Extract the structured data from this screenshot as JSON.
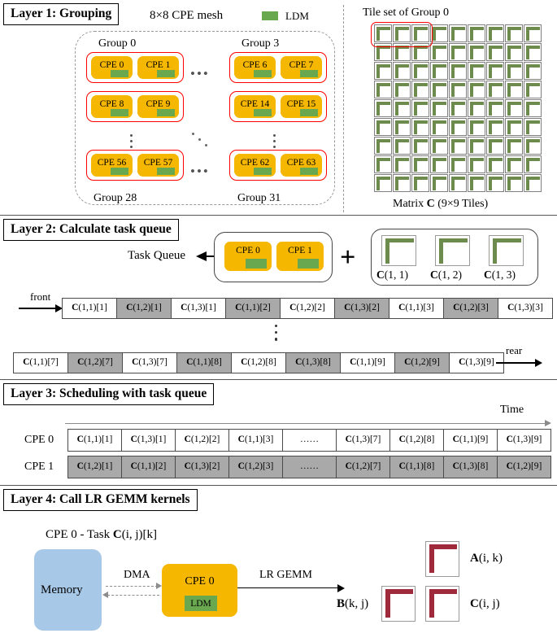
{
  "layers": [
    {
      "id": "layer1",
      "title": "Layer 1: Grouping"
    },
    {
      "id": "layer2",
      "title": "Layer 2: Calculate task queue"
    },
    {
      "id": "layer3",
      "title": "Layer 3: Scheduling with task queue"
    },
    {
      "id": "layer4",
      "title": "Layer 4: Call LR GEMM kernels"
    }
  ],
  "layer1": {
    "mesh_caption": "8×8 CPE mesh",
    "legend_label": "LDM",
    "group_labels": {
      "top_left": "Group 0",
      "top_right": "Group 3",
      "bottom_left": "Group 28",
      "bottom_right": "Group 31"
    },
    "cpe_rows": [
      {
        "left": [
          "CPE 0",
          "CPE 1"
        ],
        "right": [
          "CPE 6",
          "CPE 7"
        ]
      },
      {
        "left": [
          "CPE 8",
          "CPE 9"
        ],
        "right": [
          "CPE 14",
          "CPE 15"
        ]
      },
      {
        "left": [
          "CPE 56",
          "CPE 57"
        ],
        "right": [
          "CPE 62",
          "CPE 63"
        ]
      }
    ],
    "tileset_label": "Tile set of Group 0",
    "matrix_caption_pre": "Matrix ",
    "matrix_caption_bold": "C",
    "matrix_caption_post": " (9×9 Tiles)",
    "matrix_tiles": 9
  },
  "layer2": {
    "task_queue_label": "Task Queue",
    "cpes": [
      "CPE 0",
      "CPE 1"
    ],
    "plus": "+",
    "tiles": [
      {
        "bold": "C",
        "rest": "(1, 1)"
      },
      {
        "bold": "C",
        "rest": "(1, 2)"
      },
      {
        "bold": "C",
        "rest": "(1, 3)"
      }
    ],
    "front_label": "front",
    "rear_label": "rear",
    "queue_row1": [
      {
        "bold": "C",
        "rest": "(1,1)[1]",
        "shaded": false
      },
      {
        "bold": "C",
        "rest": "(1,2)[1]",
        "shaded": true
      },
      {
        "bold": "C",
        "rest": "(1,3)[1]",
        "shaded": false
      },
      {
        "bold": "C",
        "rest": "(1,1)[2]",
        "shaded": true
      },
      {
        "bold": "C",
        "rest": "(1,2)[2]",
        "shaded": false
      },
      {
        "bold": "C",
        "rest": "(1,3)[2]",
        "shaded": true
      },
      {
        "bold": "C",
        "rest": "(1,1)[3]",
        "shaded": false
      },
      {
        "bold": "C",
        "rest": "(1,2)[3]",
        "shaded": true
      },
      {
        "bold": "C",
        "rest": "(1,3)[3]",
        "shaded": false
      }
    ],
    "queue_row2": [
      {
        "bold": "C",
        "rest": "(1,1)[7]",
        "shaded": false
      },
      {
        "bold": "C",
        "rest": "(1,2)[7]",
        "shaded": true
      },
      {
        "bold": "C",
        "rest": "(1,3)[7]",
        "shaded": false
      },
      {
        "bold": "C",
        "rest": "(1,1)[8]",
        "shaded": true
      },
      {
        "bold": "C",
        "rest": "(1,2)[8]",
        "shaded": false
      },
      {
        "bold": "C",
        "rest": "(1,3)[8]",
        "shaded": true
      },
      {
        "bold": "C",
        "rest": "(1,1)[9]",
        "shaded": false
      },
      {
        "bold": "C",
        "rest": "(1,2)[9]",
        "shaded": true
      },
      {
        "bold": "C",
        "rest": "(1,3)[9]",
        "shaded": false
      }
    ]
  },
  "layer3": {
    "time_label": "Time",
    "rows": [
      {
        "name": "CPE 0",
        "shaded": false,
        "cells": [
          {
            "bold": "C",
            "rest": "(1,1)[1]"
          },
          {
            "bold": "C",
            "rest": "(1,3)[1]"
          },
          {
            "bold": "C",
            "rest": "(1,2)[2]"
          },
          {
            "bold": "C",
            "rest": "(1,1)[3]"
          },
          {
            "bold": "",
            "rest": "……"
          },
          {
            "bold": "C",
            "rest": "(1,3)[7]"
          },
          {
            "bold": "C",
            "rest": "(1,2)[8]"
          },
          {
            "bold": "C",
            "rest": "(1,1)[9]"
          },
          {
            "bold": "C",
            "rest": "(1,3)[9]"
          }
        ]
      },
      {
        "name": "CPE 1",
        "shaded": true,
        "cells": [
          {
            "bold": "C",
            "rest": "(1,2)[1]"
          },
          {
            "bold": "C",
            "rest": "(1,1)[2]"
          },
          {
            "bold": "C",
            "rest": "(1,3)[2]"
          },
          {
            "bold": "C",
            "rest": "(1,2)[3]"
          },
          {
            "bold": "",
            "rest": "……"
          },
          {
            "bold": "C",
            "rest": "(1,2)[7]"
          },
          {
            "bold": "C",
            "rest": "(1,1)[8]"
          },
          {
            "bold": "C",
            "rest": "(1,3)[8]"
          },
          {
            "bold": "C",
            "rest": "(1,2)[9]"
          }
        ]
      }
    ]
  },
  "layer4": {
    "task_caption_pre": "CPE 0 - Task ",
    "task_caption_bold": "C",
    "task_caption_post": "(i, j)[k]",
    "memory_label": "Memory",
    "dma_label": "DMA",
    "cpe_label": "CPE 0",
    "ldm_label": "LDM",
    "gemm_label": "LR GEMM",
    "matrices": [
      {
        "bold": "A",
        "rest": "(i, k)"
      },
      {
        "bold": "B",
        "rest": "(k, j)"
      },
      {
        "bold": "C",
        "rest": "(i, j)"
      }
    ]
  },
  "colors": {
    "cpe_orange": "#f5b700",
    "ldm_green": "#6aa84f",
    "tile_green": "#6e8b4e",
    "group_red": "#ff0000",
    "memory_blue": "#a8c8e8",
    "matrix_red": "#9e2a3c",
    "shade_gray": "#a9a9a9"
  }
}
